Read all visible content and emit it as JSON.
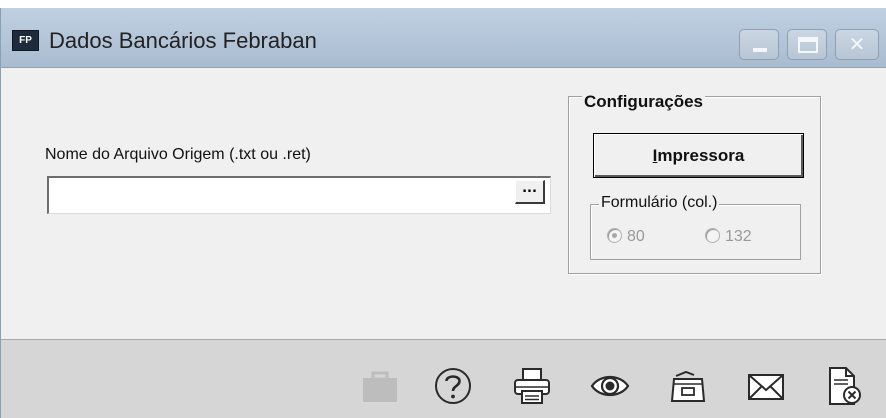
{
  "window": {
    "app_icon_text": "FP",
    "title": "Dados Bancários Febraban",
    "title_controls": [
      "minimize-button",
      "maximize-button",
      "close-button"
    ]
  },
  "file_field": {
    "label": "Nome do Arquivo Origem (.txt ou .ret)",
    "value": "",
    "browse_label": "..."
  },
  "config": {
    "legend": "Configurações",
    "printer_button_accel": "I",
    "printer_button_rest": "mpressora",
    "form_legend": "Formulário (col.)",
    "options": [
      {
        "label": "80",
        "selected": true,
        "enabled": false
      },
      {
        "label": "132",
        "selected": false,
        "enabled": false
      }
    ]
  },
  "toolbar": {
    "icons": [
      "briefcase-icon",
      "help-icon",
      "print-icon",
      "preview-icon",
      "archive-icon",
      "mail-icon",
      "close-document-icon"
    ],
    "disabled_icon_color": "#bdbdbd",
    "icon_color": "#2a2a2a"
  },
  "colors": {
    "titlebar": "#b4c4d6",
    "window_bg": "#f0f0f0",
    "toolbar_bg": "#d6d6d6"
  }
}
